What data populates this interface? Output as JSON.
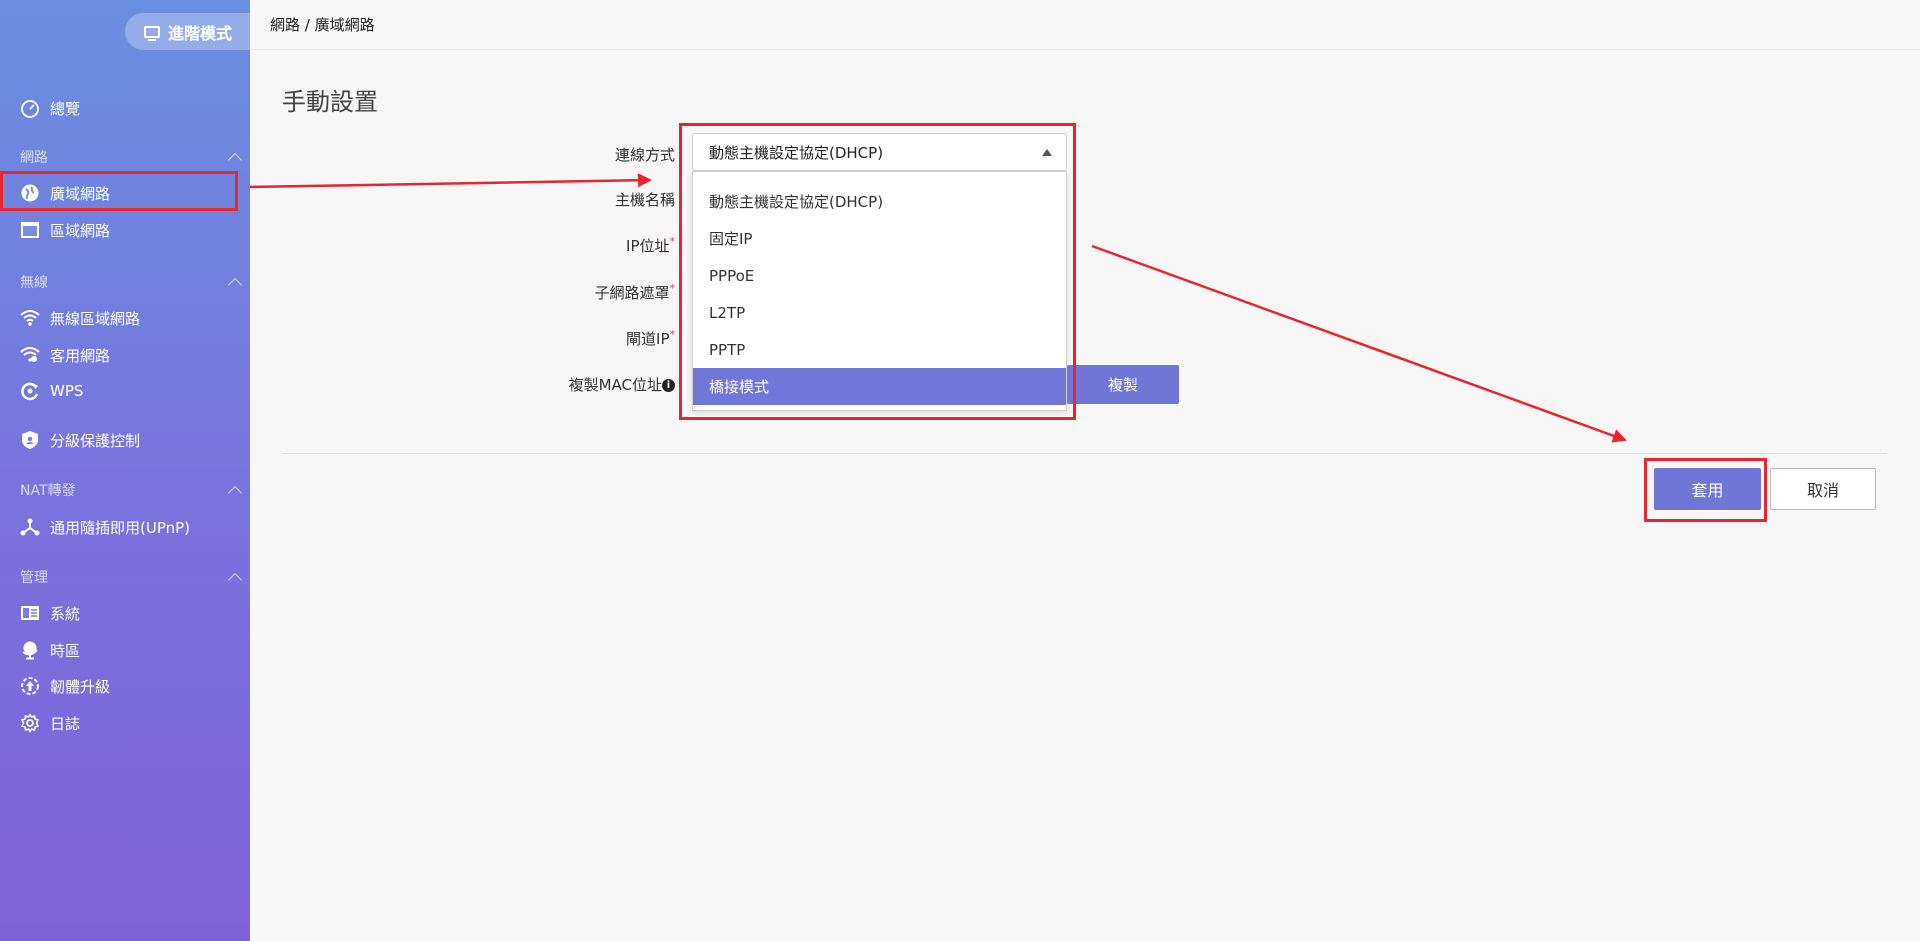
{
  "sidebar": {
    "mode_label": "進階模式",
    "items": {
      "overview": "總覽",
      "network_group": "網路",
      "wan": "廣域網路",
      "lan": "區域網路",
      "wireless_group": "無線",
      "wlan": "無線區域網路",
      "guest": "客用網路",
      "wps": "WPS",
      "parental": "分級保護控制",
      "nat_group": "NAT轉發",
      "upnp": "通用隨插即用(UPnP)",
      "mgmt_group": "管理",
      "system": "系統",
      "timezone": "時區",
      "firmware": "韌體升級",
      "log": "日誌"
    }
  },
  "breadcrumb": "網路 / 廣域網路",
  "page_title": "手動設置",
  "form": {
    "connection_type_label": "連線方式",
    "hostname_label": "主機名稱",
    "ip_label": "IP位址",
    "subnet_label": "子網路遮罩",
    "gateway_label": "閘道IP",
    "clone_mac_label": "複製MAC位址",
    "required_mark": "*",
    "info_glyph": "i",
    "selected_value": "動態主機設定協定(DHCP)",
    "options": [
      "動態主機設定協定(DHCP)",
      "固定IP",
      "PPPoE",
      "L2TP",
      "PPTP",
      "橋接模式"
    ],
    "highlighted_option_index": 5,
    "clone_button": "複製"
  },
  "actions": {
    "apply": "套用",
    "cancel": "取消"
  },
  "colors": {
    "accent": "#6f76d6",
    "annotation_red": "#e8262d"
  }
}
